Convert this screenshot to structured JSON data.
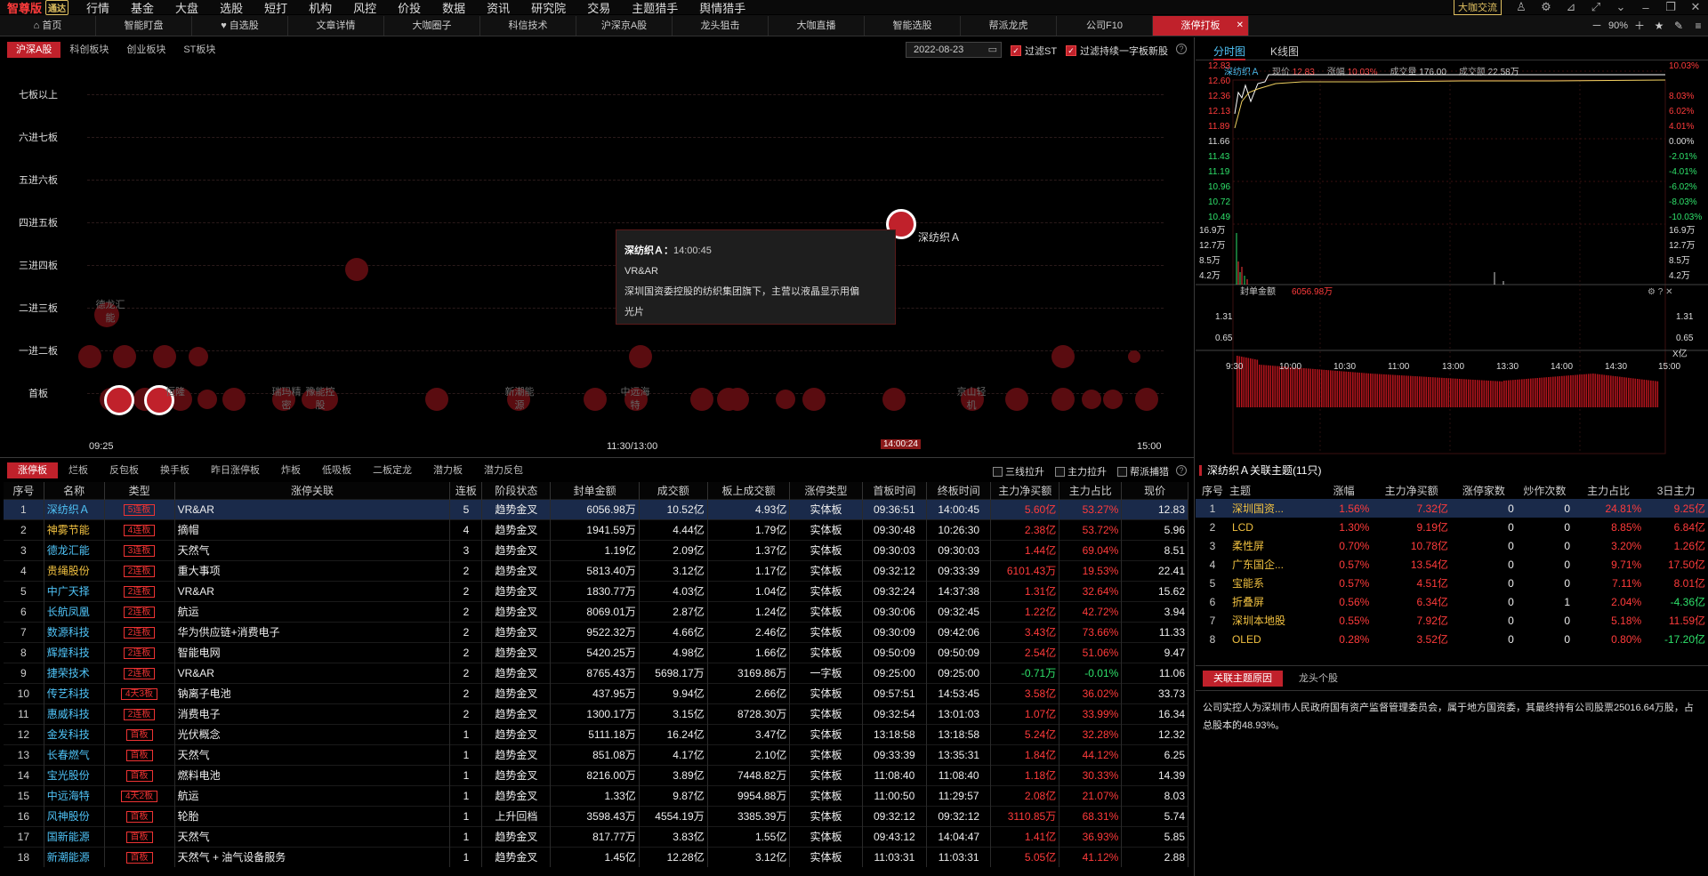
{
  "menubar": {
    "app_name": "智尊版",
    "app_version": "通达",
    "items": [
      "行情",
      "基金",
      "大盘",
      "选股",
      "短打",
      "机构",
      "风控",
      "价投",
      "数据",
      "资讯",
      "研究院",
      "交易",
      "主题猎手",
      "舆情猎手"
    ],
    "dakaxinliu": "大咖交流"
  },
  "tabs": [
    {
      "label": "首页",
      "icon": "home-icon"
    },
    {
      "label": "智能盯盘"
    },
    {
      "label": "自选股",
      "icon": "heart-icon"
    },
    {
      "label": "文章详情"
    },
    {
      "label": "大咖圈子"
    },
    {
      "label": "科信技术"
    },
    {
      "label": "沪深京A股"
    },
    {
      "label": "龙头狙击"
    },
    {
      "label": "大咖直播"
    },
    {
      "label": "智能选股"
    },
    {
      "label": "帮派龙虎"
    },
    {
      "label": "公司F10"
    },
    {
      "label": "涨停打板",
      "active": true
    }
  ],
  "zoom": "90%",
  "filter": {
    "markets": [
      "沪深A股",
      "科创板块",
      "创业板块",
      "ST板块"
    ],
    "active_market": "沪深A股",
    "date": "2022-08-23",
    "filter_st": "过滤ST",
    "filter_new": "过滤持续一字板新股"
  },
  "ladder": {
    "rows": [
      "七板以上",
      "六进七板",
      "五进六板",
      "四进五板",
      "三进四板",
      "二进三板",
      "一进二板",
      "首板"
    ],
    "x_ticks": [
      "09:25",
      "11:30/13:00",
      "15:00"
    ],
    "cursor_time": "14:00:24",
    "labels": [
      "德龙汇\n能",
      "瑞玛精\n密",
      "豫能控\n股",
      "新潮能\n源",
      "中远海\n特",
      "恒隆\n",
      "京山轻\n机"
    ],
    "highlight_name": "深纺织Ａ",
    "tooltip": {
      "title": "深纺织Ａ：",
      "time": "14:00:45",
      "theme": "VR&AR",
      "desc1": "深圳国资委控股的纺织集团旗下，主营以液晶显示用偏",
      "desc2": "光片"
    }
  },
  "right_chart": {
    "tab_intraday": "分时图",
    "tab_kline": "K线图",
    "info": {
      "name": "深纺织Ａ",
      "price_label": "现价",
      "price": "12.83",
      "pct_label": "涨幅",
      "pct": "10.03%",
      "vol_label": "成交量",
      "vol": "176.00",
      "amt_label": "成交额",
      "amt": "22.58万"
    },
    "price_axis": [
      "12.83",
      "12.60",
      "12.36",
      "12.13",
      "11.89",
      "11.66",
      "11.43",
      "11.19",
      "10.96",
      "10.72",
      "10.49"
    ],
    "pct_axis": [
      "10.03%",
      "8.03%",
      "6.02%",
      "4.01%",
      "2.01%",
      "0.00%",
      "-2.01%",
      "-4.01%",
      "-6.02%",
      "-8.03%",
      "-10.03%"
    ],
    "vol_axis": [
      "16.9万",
      "12.7万",
      "8.5万",
      "4.2万"
    ],
    "seal_label": "封单金额",
    "seal_value": "6056.98万",
    "seal_axis": [
      "1.31",
      "0.65"
    ],
    "seal_unit": "X亿",
    "time_axis": [
      "9:30",
      "10:00",
      "10:30",
      "11:00",
      "13:00",
      "13:30",
      "14:00",
      "14:30",
      "15:00"
    ]
  },
  "bottom_tabs": [
    "涨停板",
    "烂板",
    "反包板",
    "换手板",
    "昨日涨停板",
    "炸板",
    "低吸板",
    "二板定龙",
    "潜力板",
    "潜力反包"
  ],
  "toggles": [
    "三线拉升",
    "主力拉升",
    "帮派捕猎"
  ],
  "table": {
    "headers": [
      "序号",
      "名称",
      "类型",
      "涨停关联",
      "连板",
      "阶段状态",
      "封单金额",
      "成交额",
      "板上成交额",
      "涨停类型",
      "首板时间",
      "终板时间",
      "主力净买额",
      "主力占比",
      "现价"
    ],
    "rows": [
      [
        "1",
        "深纺织Ａ",
        "5连板",
        "VR&AR",
        "5",
        "趋势金叉",
        "6056.98万",
        "10.52亿",
        "4.93亿",
        "实体板",
        "09:36:51",
        "14:00:45",
        "5.60亿",
        "53.27%",
        "12.83"
      ],
      [
        "2",
        "神雾节能",
        "4连板",
        "摘帽",
        "4",
        "趋势金叉",
        "1941.59万",
        "4.44亿",
        "1.79亿",
        "实体板",
        "09:30:48",
        "10:26:30",
        "2.38亿",
        "53.72%",
        "5.96"
      ],
      [
        "3",
        "德龙汇能",
        "3连板",
        "天然气",
        "3",
        "趋势金叉",
        "1.19亿",
        "2.09亿",
        "1.37亿",
        "实体板",
        "09:30:03",
        "09:30:03",
        "1.44亿",
        "69.04%",
        "8.51"
      ],
      [
        "4",
        "贵绳股份",
        "2连板",
        "重大事项",
        "2",
        "趋势金叉",
        "5813.40万",
        "3.12亿",
        "1.17亿",
        "实体板",
        "09:32:12",
        "09:33:39",
        "6101.43万",
        "19.53%",
        "22.41"
      ],
      [
        "5",
        "中广天择",
        "2连板",
        "VR&AR",
        "2",
        "趋势金叉",
        "1830.77万",
        "4.03亿",
        "1.04亿",
        "实体板",
        "09:32:24",
        "14:37:38",
        "1.31亿",
        "32.64%",
        "15.62"
      ],
      [
        "6",
        "长航凤凰",
        "2连板",
        "航运",
        "2",
        "趋势金叉",
        "8069.01万",
        "2.87亿",
        "1.24亿",
        "实体板",
        "09:30:06",
        "09:32:45",
        "1.22亿",
        "42.72%",
        "3.94"
      ],
      [
        "7",
        "数源科技",
        "2连板",
        "华为供应链+消费电子",
        "2",
        "趋势金叉",
        "9522.32万",
        "4.66亿",
        "2.46亿",
        "实体板",
        "09:30:09",
        "09:42:06",
        "3.43亿",
        "73.66%",
        "11.33"
      ],
      [
        "8",
        "辉煌科技",
        "2连板",
        "智能电网",
        "2",
        "趋势金叉",
        "5420.25万",
        "4.98亿",
        "1.66亿",
        "实体板",
        "09:50:09",
        "09:50:09",
        "2.54亿",
        "51.06%",
        "9.47"
      ],
      [
        "9",
        "捷荣技术",
        "2连板",
        "VR&AR",
        "2",
        "趋势金叉",
        "8765.43万",
        "5698.17万",
        "3169.86万",
        "一字板",
        "09:25:00",
        "09:25:00",
        "-0.71万",
        "-0.01%",
        "11.06"
      ],
      [
        "10",
        "传艺科技",
        "4天3板",
        "钠离子电池",
        "2",
        "趋势金叉",
        "437.95万",
        "9.94亿",
        "2.66亿",
        "实体板",
        "09:57:51",
        "14:53:45",
        "3.58亿",
        "36.02%",
        "33.73"
      ],
      [
        "11",
        "惠威科技",
        "2连板",
        "消费电子",
        "2",
        "趋势金叉",
        "1300.17万",
        "3.15亿",
        "8728.30万",
        "实体板",
        "09:32:54",
        "13:01:03",
        "1.07亿",
        "33.99%",
        "16.34"
      ],
      [
        "12",
        "金发科技",
        "首板",
        "光伏概念",
        "1",
        "趋势金叉",
        "5111.18万",
        "16.24亿",
        "3.47亿",
        "实体板",
        "13:18:58",
        "13:18:58",
        "5.24亿",
        "32.28%",
        "12.32"
      ],
      [
        "13",
        "长春燃气",
        "首板",
        "天然气",
        "1",
        "趋势金叉",
        "851.08万",
        "4.17亿",
        "2.10亿",
        "实体板",
        "09:33:39",
        "13:35:31",
        "1.84亿",
        "44.12%",
        "6.25"
      ],
      [
        "14",
        "宝光股份",
        "首板",
        "燃料电池",
        "1",
        "趋势金叉",
        "8216.00万",
        "3.89亿",
        "7448.82万",
        "实体板",
        "11:08:40",
        "11:08:40",
        "1.18亿",
        "30.33%",
        "14.39"
      ],
      [
        "15",
        "中远海特",
        "4天2板",
        "航运",
        "1",
        "趋势金叉",
        "1.33亿",
        "9.87亿",
        "9954.88万",
        "实体板",
        "11:00:50",
        "11:29:57",
        "2.08亿",
        "21.07%",
        "8.03"
      ],
      [
        "16",
        "风神股份",
        "首板",
        "轮胎",
        "1",
        "上升回档",
        "3598.43万",
        "4554.19万",
        "3385.39万",
        "实体板",
        "09:32:12",
        "09:32:12",
        "3110.85万",
        "68.31%",
        "5.74"
      ],
      [
        "17",
        "国新能源",
        "首板",
        "天然气",
        "1",
        "趋势金叉",
        "817.77万",
        "3.83亿",
        "1.55亿",
        "实体板",
        "09:43:12",
        "14:04:47",
        "1.41亿",
        "36.93%",
        "5.85"
      ],
      [
        "18",
        "新潮能源",
        "首板",
        "天然气 + 油气设备服务",
        "1",
        "趋势金叉",
        "1.45亿",
        "12.28亿",
        "3.12亿",
        "实体板",
        "11:03:31",
        "11:03:31",
        "5.05亿",
        "41.12%",
        "2.88"
      ]
    ]
  },
  "related": {
    "title": "深纺织Ａ关联主题(11只)",
    "headers": [
      "序号",
      "主题",
      "涨幅",
      "主力净买额",
      "涨停家数",
      "炒作次数",
      "主力占比",
      "3日主力"
    ],
    "rows": [
      [
        "1",
        "深圳国资...",
        "1.56%",
        "7.32亿",
        "0",
        "0",
        "24.81%",
        "9.25亿"
      ],
      [
        "2",
        "LCD",
        "1.30%",
        "9.19亿",
        "0",
        "0",
        "8.85%",
        "6.84亿"
      ],
      [
        "3",
        "柔性屏",
        "0.70%",
        "10.78亿",
        "0",
        "0",
        "3.20%",
        "1.26亿"
      ],
      [
        "4",
        "广东国企...",
        "0.57%",
        "13.54亿",
        "0",
        "0",
        "9.71%",
        "17.50亿"
      ],
      [
        "5",
        "宝能系",
        "0.57%",
        "4.51亿",
        "0",
        "0",
        "7.11%",
        "8.01亿"
      ],
      [
        "6",
        "折叠屏",
        "0.56%",
        "6.34亿",
        "0",
        "1",
        "2.04%",
        "-4.36亿"
      ],
      [
        "7",
        "深圳本地股",
        "0.55%",
        "7.92亿",
        "0",
        "0",
        "5.18%",
        "11.59亿"
      ],
      [
        "8",
        "OLED",
        "0.28%",
        "3.52亿",
        "0",
        "0",
        "0.80%",
        "-17.20亿"
      ]
    ],
    "tab_reason": "关联主题原因",
    "tab_stocks": "龙头个股",
    "reason": "公司实控人为深圳市人民政府国有资产监督管理委员会，属于地方国资委，其最终持有公司股票25016.64万股，占总股本的48.93%。"
  },
  "colors": {
    "accent": "#c0212b",
    "up": "#ff3b3b",
    "down": "#2ee06a",
    "name": "#4fc3f7"
  }
}
